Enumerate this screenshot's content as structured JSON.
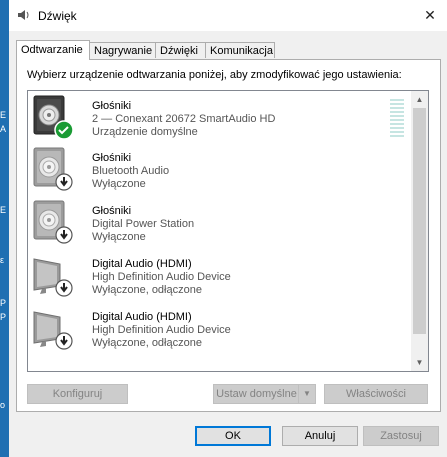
{
  "window": {
    "title": "Dźwięk",
    "close_symbol": "✕"
  },
  "tabs": [
    {
      "label": "Odtwarzanie",
      "active": true
    },
    {
      "label": "Nagrywanie",
      "active": false
    },
    {
      "label": "Dźwięki",
      "active": false
    },
    {
      "label": "Komunikacja",
      "active": false
    }
  ],
  "instruction": "Wybierz urządzenie odtwarzania poniżej, aby zmodyfikować jego ustawienia:",
  "devices": [
    {
      "name": "Głośniki",
      "line2": "2 — Conexant 20672 SmartAudio HD",
      "line3": "Urządzenie domyślne",
      "icon": "speaker-icon",
      "badge": "check-badge-icon",
      "enabled": true
    },
    {
      "name": "Głośniki",
      "line2": "Bluetooth Audio",
      "line3": "Wyłączone",
      "icon": "speaker-icon",
      "badge": "disabled-arrow-badge-icon",
      "enabled": false
    },
    {
      "name": "Głośniki",
      "line2": "Digital Power Station",
      "line3": "Wyłączone",
      "icon": "speaker-icon",
      "badge": "disabled-arrow-badge-icon",
      "enabled": false
    },
    {
      "name": "Digital Audio (HDMI)",
      "line2": "High Definition Audio Device",
      "line3": "Wyłączone, odłączone",
      "icon": "monitor-icon",
      "badge": "disabled-arrow-badge-icon",
      "enabled": false
    },
    {
      "name": "Digital Audio (HDMI)",
      "line2": "High Definition Audio Device",
      "line3": "Wyłączone, odłączone",
      "icon": "monitor-icon",
      "badge": "disabled-arrow-badge-icon",
      "enabled": false
    }
  ],
  "buttons": {
    "configure": "Konfiguruj",
    "set_default": "Ustaw domyślne",
    "properties": "Właściwości",
    "ok": "OK",
    "cancel": "Anuluj",
    "apply": "Zastosuj"
  },
  "background_letters": [
    "E",
    "A",
    "E",
    "ε",
    "P",
    "P",
    "o"
  ],
  "colors": {
    "check_badge": "#1a9b34",
    "level_meter": "#c6e5e2",
    "focus": "#0078d7"
  }
}
